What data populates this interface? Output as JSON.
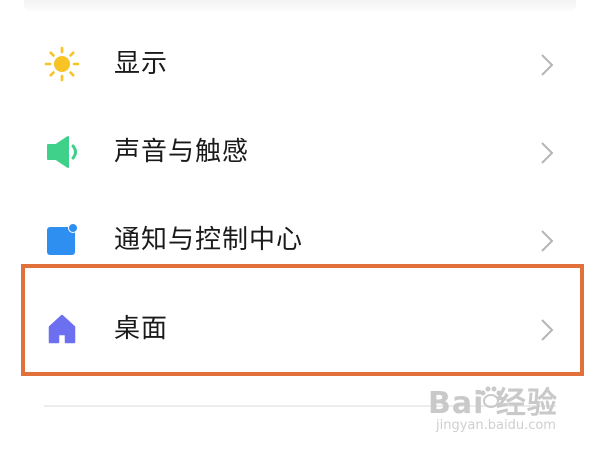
{
  "settings": {
    "items": [
      {
        "label": "显示",
        "icon": "sun-icon",
        "color": "#f7c325"
      },
      {
        "label": "声音与触感",
        "icon": "speaker-icon",
        "color": "#3fd08a"
      },
      {
        "label": "通知与控制中心",
        "icon": "notification-icon",
        "color": "#2f8ff0"
      },
      {
        "label": "桌面",
        "icon": "home-icon",
        "color": "#6c6ff0"
      }
    ],
    "highlighted_item": "桌面",
    "highlight_color": "#e2703a"
  },
  "watermark": {
    "main": "Bai 经验",
    "sub": "jingyan.baidu.com"
  }
}
